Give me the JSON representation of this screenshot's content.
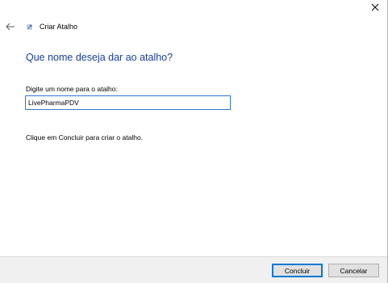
{
  "window": {
    "close_glyph": "×"
  },
  "header": {
    "back_icon": "back-arrow-icon",
    "wizard_icon": "shortcut-wizard-icon",
    "title": "Criar Atalho"
  },
  "main": {
    "heading": "Que nome deseja dar ao atalho?",
    "field_label": "Digite um nome para o atalho:",
    "name_value": "LivePharmaPDV",
    "hint": "Clique em Concluir para criar o atalho."
  },
  "footer": {
    "finish_label": "Concluir",
    "cancel_label": "Cancelar"
  },
  "colors": {
    "heading": "#1a3f9c",
    "input_focus_border": "#3079d6",
    "primary_button_border": "#0078d7",
    "footer_bg": "#f0f0f0"
  }
}
